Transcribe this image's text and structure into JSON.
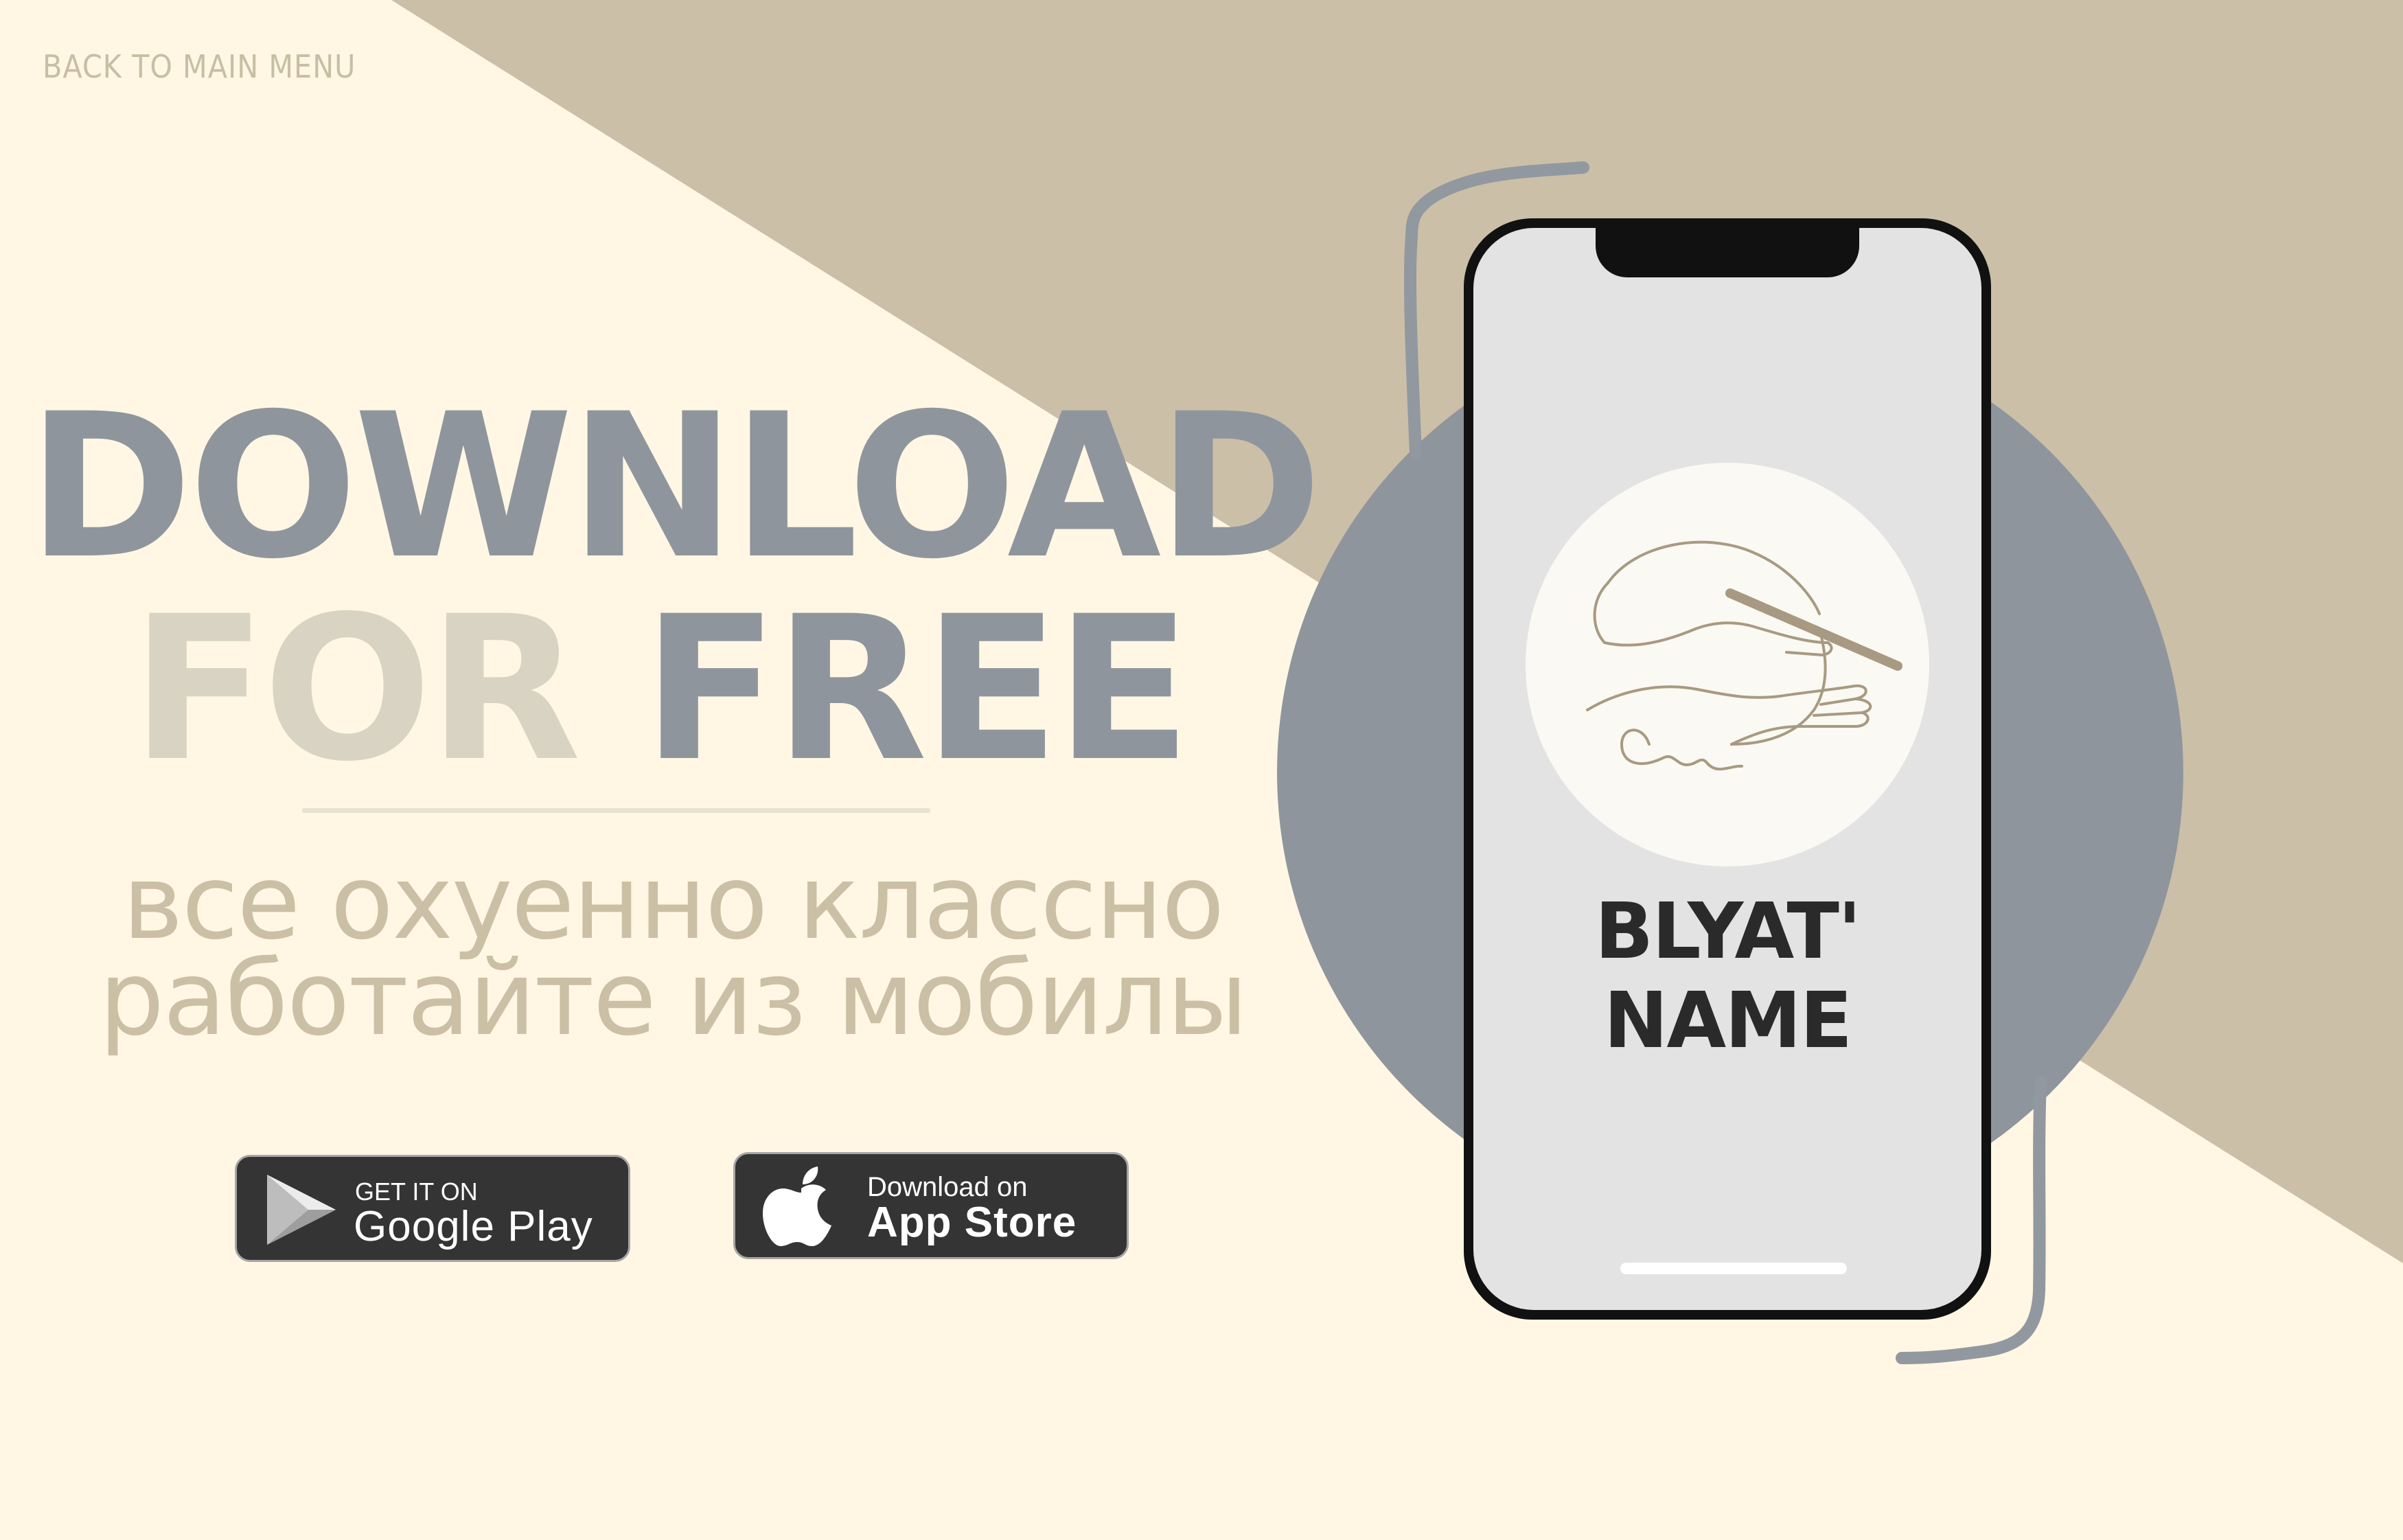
{
  "nav": {
    "back_label": "BACK TO MAIN MENU"
  },
  "hero": {
    "line1": "DOWNLOAD",
    "line2_a": "FOR",
    "line2_b": "FREE",
    "tagline_1": "все охуенно классно",
    "tagline_2": "работайте из мобилы"
  },
  "stores": {
    "google": {
      "small": "GET IT ON",
      "big": "Google Play",
      "icon": "google-play-icon"
    },
    "apple": {
      "small": "Download on",
      "big": "App Store",
      "icon": "apple-icon"
    }
  },
  "phone": {
    "app_name": "BLYAT' NAME",
    "logo_icon": "hand-signing-logo"
  },
  "colors": {
    "background": "#fff7e3",
    "diagonal": "#cbbfa7",
    "circle": "#8f959d",
    "headline": "#8f959d",
    "accent": "#cbbfa5"
  }
}
